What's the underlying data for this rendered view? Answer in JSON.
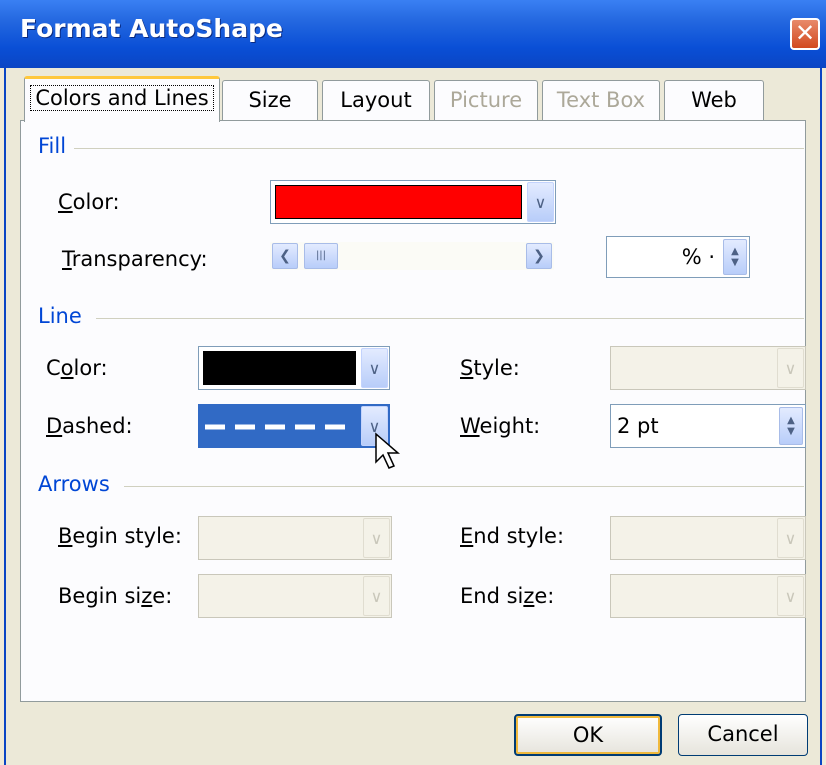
{
  "window": {
    "title": "Format AutoShape",
    "close_glyph": "✕"
  },
  "tabs": [
    {
      "label": "Colors and Lines",
      "state": "active"
    },
    {
      "label": "Size",
      "state": "enabled"
    },
    {
      "label": "Layout",
      "state": "enabled"
    },
    {
      "label": "Picture",
      "state": "disabled"
    },
    {
      "label": "Text Box",
      "state": "disabled"
    },
    {
      "label": "Web",
      "state": "enabled"
    }
  ],
  "fill": {
    "section_label": "Fill",
    "color_label": "Color:",
    "color_value": "#ff0000",
    "transparency_label": "Transparency:",
    "transparency_value": "% ·"
  },
  "line": {
    "section_label": "Line",
    "color_label": "Color:",
    "color_value": "#000000",
    "dashed_label": "Dashed:",
    "style_label": "Style:",
    "weight_label": "Weight:",
    "weight_value": "2 pt"
  },
  "arrows": {
    "section_label": "Arrows",
    "begin_style_label": "Begin style:",
    "end_style_label": "End style:",
    "begin_size_label": "Begin size:",
    "end_size_label": "End size:"
  },
  "buttons": {
    "ok": "OK",
    "cancel": "Cancel"
  },
  "colors": {
    "accent": "#0046d5",
    "titlebar": "#0b45c4",
    "selection": "#316ac5"
  }
}
